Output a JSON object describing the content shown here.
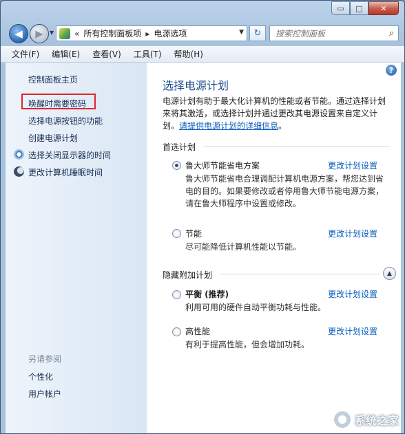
{
  "window": {
    "caption": {
      "minimize": "▭",
      "maximize": "□",
      "close": "✕"
    }
  },
  "nav": {
    "back": "◀",
    "forward": "▶",
    "recent_pages": "▼"
  },
  "address": {
    "prefix": "«",
    "crumbs": [
      "所有控制面板项",
      "电源选项"
    ],
    "separator": "▸",
    "dropdown": "▼"
  },
  "refresh": "↻",
  "search": {
    "placeholder": "搜索控制面板",
    "icon": "⌕"
  },
  "menubar": {
    "items": [
      "文件(F)",
      "编辑(E)",
      "查看(V)",
      "工具(T)",
      "帮助(H)"
    ]
  },
  "sidebar": {
    "home": "控制面板主页",
    "links": [
      "唤醒时需要密码",
      "选择电源按钮的功能",
      "创建电源计划",
      "选择关闭显示器的时间",
      "更改计算机睡眠时间"
    ],
    "see_also_title": "另请参阅",
    "see_also": [
      "个性化",
      "用户帐户"
    ]
  },
  "main": {
    "help": "?",
    "title": "选择电源计划",
    "description": "电源计划有助于最大化计算机的性能或者节能。通过选择计划来将其激活，或选择计划并通过更改其电源设置来自定义计划。",
    "description_link": "请提供电源计划的详细信息",
    "description_end": "。",
    "preferred_heading": "首选计划",
    "hidden_heading": "隐藏附加计划",
    "collapse_icon": "▲",
    "change_label": "更改计划设置",
    "plans": [
      {
        "name": "鲁大师节能省电方案",
        "selected": true,
        "desc": "鲁大师节能省电合理调配计算机电源方案，帮您达到省电的目的。如果要修改或者停用鲁大师节能电源方案，请在鲁大师程序中设置或修改。"
      },
      {
        "name": "节能",
        "selected": false,
        "desc": "尽可能降低计算机性能以节能。"
      },
      {
        "name": "平衡 (推荐)",
        "selected": false,
        "desc": "利用可用的硬件自动平衡功耗与性能。"
      },
      {
        "name": "高性能",
        "selected": false,
        "desc": "有利于提高性能，但会增加功耗。"
      }
    ]
  },
  "watermark": {
    "text": "系统之家"
  }
}
